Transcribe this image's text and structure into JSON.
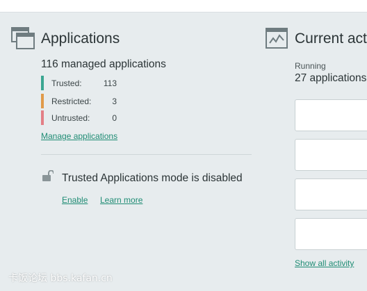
{
  "applications": {
    "title": "Applications",
    "managed_count": "116 managed applications",
    "stats": [
      {
        "label": "Trusted:",
        "value": "113",
        "color": "#3aa691"
      },
      {
        "label": "Restricted:",
        "value": "3",
        "color": "#e09a4a"
      },
      {
        "label": "Untrusted:",
        "value": "0",
        "color": "#e37f86"
      }
    ],
    "manage_link": "Manage applications",
    "trusted_mode": {
      "message": "Trusted Applications mode is disabled",
      "enable_link": "Enable",
      "learn_more_link": "Learn more"
    }
  },
  "current_activity": {
    "title": "Current acti",
    "running_label": "Running",
    "running_count": "27 applications",
    "show_all_link": "Show all activity"
  },
  "watermark": "卡饭论坛 bbs.kafan.cn",
  "colors": {
    "accent": "#1f8c74",
    "background": "#e7ecee",
    "icon": "#6f7c80"
  }
}
